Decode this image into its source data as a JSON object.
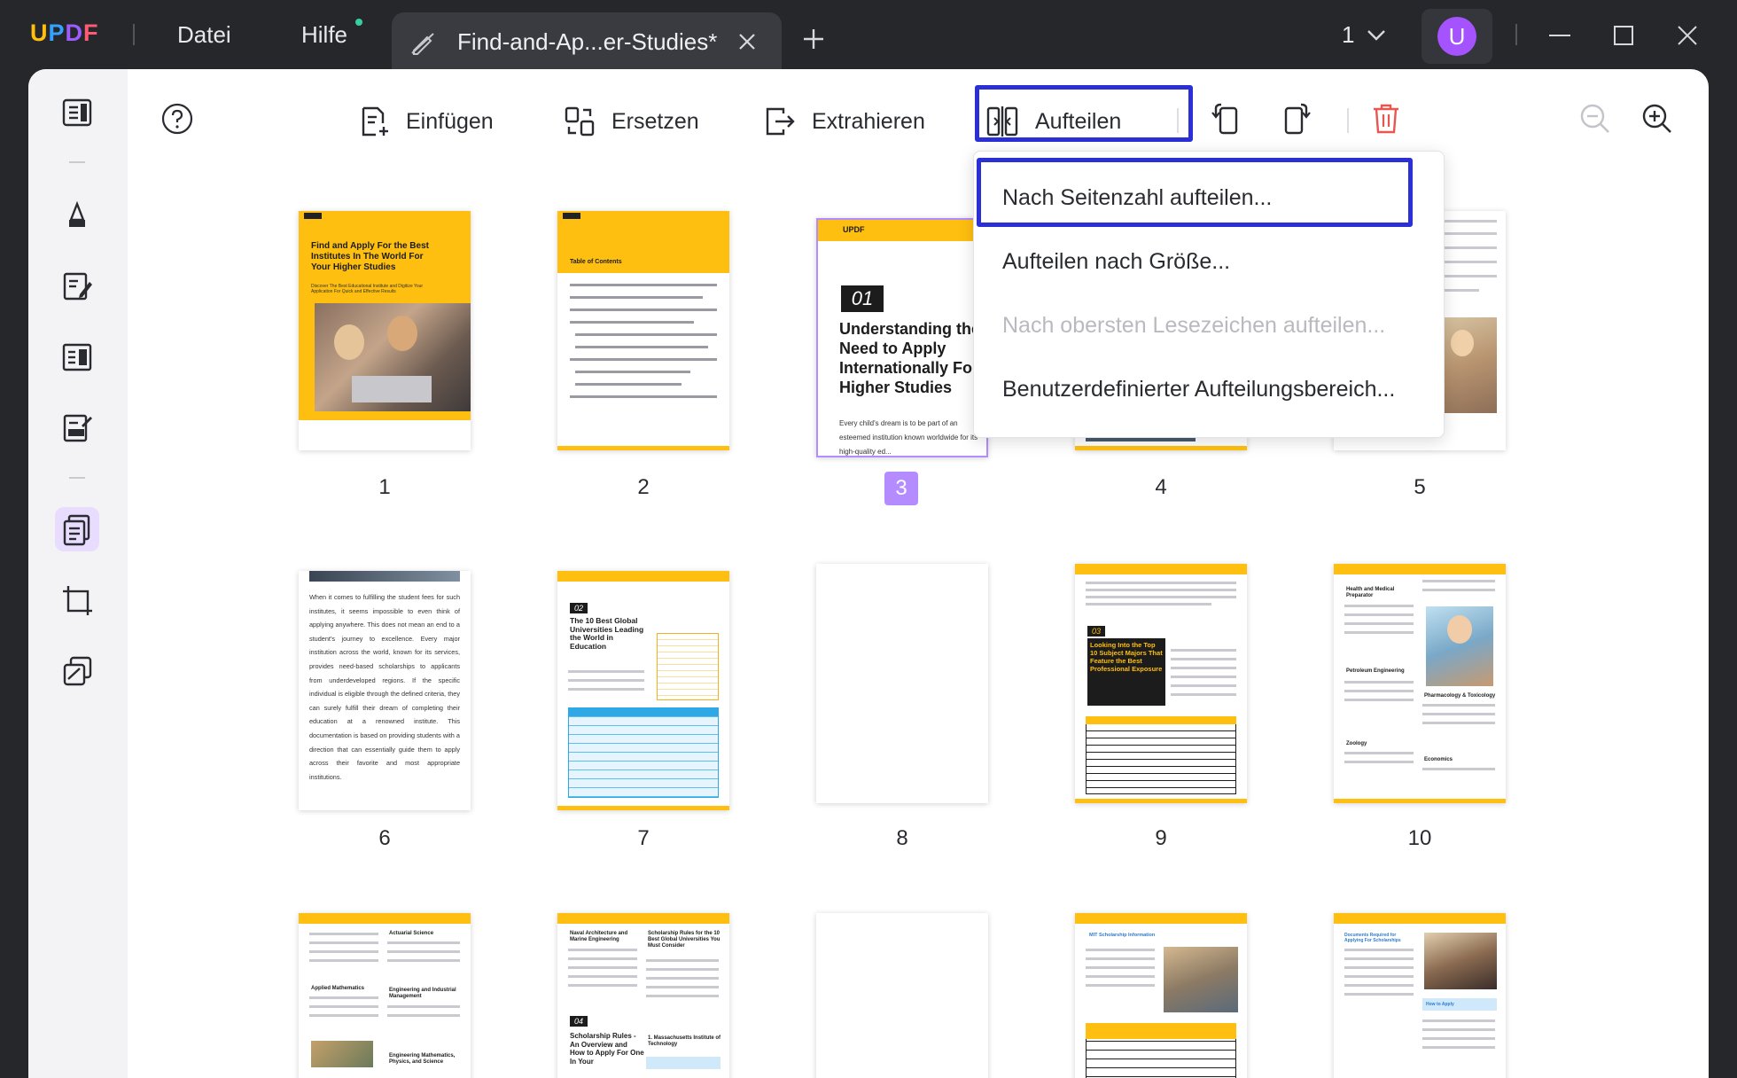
{
  "app": {
    "logo": "UPDF",
    "menu": {
      "file": "Datei",
      "help": "Hilfe"
    },
    "tab": {
      "title": "Find-and-Ap...er-Studies*"
    },
    "page_indicator": "1",
    "avatar_initial": "U"
  },
  "toolbar": {
    "insert": "Einfügen",
    "replace": "Ersetzen",
    "extract": "Extrahieren",
    "split": "Aufteilen"
  },
  "split_menu": {
    "items": [
      {
        "label": "Nach Seitenzahl aufteilen...",
        "enabled": true,
        "highlighted": true
      },
      {
        "label": "Aufteilen nach Größe...",
        "enabled": true
      },
      {
        "label": "Nach obersten Lesezeichen aufteilen...",
        "enabled": false
      },
      {
        "label": "Benutzerdefinierter Aufteilungsbereich...",
        "enabled": true
      }
    ]
  },
  "pages": {
    "selected": 3,
    "numbers": [
      "1",
      "2",
      "3",
      "4",
      "5",
      "6",
      "7",
      "8",
      "9",
      "10"
    ],
    "p1": {
      "title": "Find and Apply For the Best Institutes In The World For Your Higher Studies",
      "subtitle": "Discover The Best Educational Institute and Digitize Your Application For Quick and Effective Results"
    },
    "p2": {
      "heading": "Table of Contents"
    },
    "p3": {
      "brand": "UPDF",
      "chapter": "01",
      "heading": "Understanding the Need to Apply Internationally For Higher Studies",
      "body": "Every child's dream is to be part of an esteemed institution known worldwide for its high-quality ed..."
    },
    "p6": {
      "body": "When it comes to fulfilling the student fees for such institutes, it seems impossible to even think of applying anywhere. This does not mean an end to a student's journey to excellence. Every major institution across the world, known for its services, provides need-based scholarships to applicants from underdeveloped regions. If the specific individual is eligible through the defined criteria, they can surely fulfill their dream of completing their education at a renowned institute. This documentation is based on providing students with a direction that can essentially guide them to apply across their favorite and most appropriate institutions."
    },
    "p7": {
      "chapter": "02",
      "heading": "The 10 Best Global Universities Leading the World in Education"
    },
    "p9": {
      "chapter": "03",
      "heading": "Looking Into the Top 10 Subject Majors That Feature the Best Professional Exposure"
    },
    "p10": {
      "items": [
        "Health and Medical Preparator",
        "Petroleum Engineering",
        "Pharmacology & Toxicology",
        "Zoology",
        "Economics"
      ]
    },
    "p11": {
      "items": [
        "Actuarial Science",
        "Applied Mathematics",
        "Engineering and Industrial Management",
        "Engineering Mathematics, Physics, and Science"
      ]
    },
    "p12": {
      "items": [
        "Naval Architecture and Marine Engineering",
        "Scholarship Rules for the 10 Best Global Universities You Must Consider",
        "1. Massachusetts Institute of Technology"
      ],
      "chapter": "04",
      "heading": "Scholarship Rules - An Overview and How to Apply For One In Your"
    },
    "p14": {
      "heading": "MIT Scholarship Information"
    },
    "p15": {
      "heading": "Documents Required for Applying For Scholarships",
      "subheading": "How to Apply"
    }
  },
  "colors": {
    "accent_purple": "#9d5cff",
    "highlight_blue": "#2a2fd6",
    "brand_yellow": "#ffbf10",
    "delete_red": "#e8574f"
  }
}
